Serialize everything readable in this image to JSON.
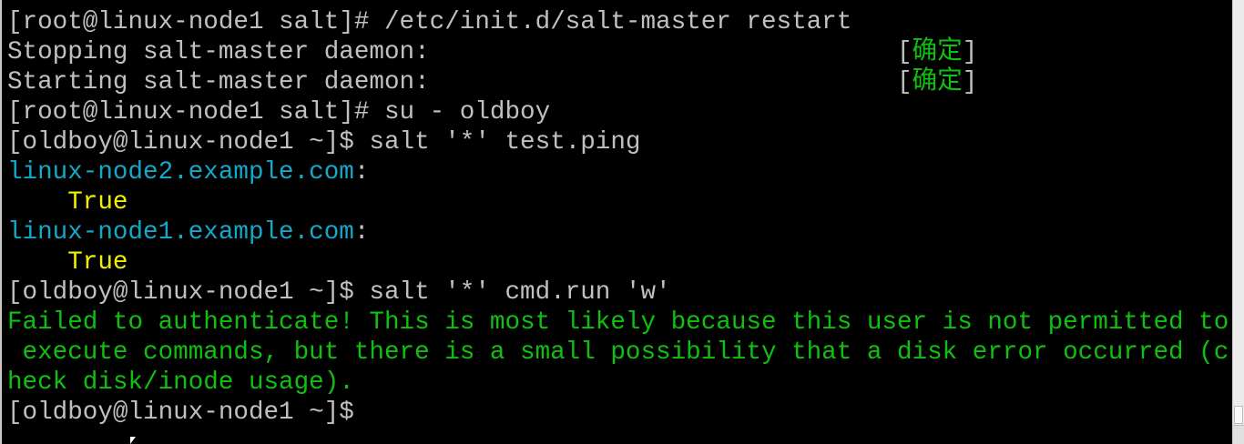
{
  "colors": {
    "default": "#c0c0c0",
    "cyan": "#14a8c8",
    "yellow": "#f0f000",
    "green": "#10c010"
  },
  "lines": [
    [
      {
        "t": "[root@linux-node1 salt]# /etc/init.d/salt-master restart",
        "c": "default"
      }
    ],
    [
      {
        "t": "Stopping salt-master daemon:                               ",
        "c": "default"
      },
      {
        "t": "[",
        "c": "default"
      },
      {
        "t": "确定",
        "c": "green"
      },
      {
        "t": "]",
        "c": "default"
      }
    ],
    [
      {
        "t": "Starting salt-master daemon:                               ",
        "c": "default"
      },
      {
        "t": "[",
        "c": "default"
      },
      {
        "t": "确定",
        "c": "green"
      },
      {
        "t": "]",
        "c": "default"
      }
    ],
    [
      {
        "t": "[root@linux-node1 salt]# su - oldboy",
        "c": "default"
      }
    ],
    [
      {
        "t": "[oldboy@linux-node1 ~]$ salt '*' test.ping",
        "c": "default"
      }
    ],
    [
      {
        "t": "linux-node2.example.com",
        "c": "cyan"
      },
      {
        "t": ":",
        "c": "default"
      }
    ],
    [
      {
        "t": "    True",
        "c": "yellow"
      }
    ],
    [
      {
        "t": "linux-node1.example.com",
        "c": "cyan"
      },
      {
        "t": ":",
        "c": "default"
      }
    ],
    [
      {
        "t": "    True",
        "c": "yellow"
      }
    ],
    [
      {
        "t": "[oldboy@linux-node1 ~]$ salt '*' cmd.run 'w'",
        "c": "default"
      }
    ],
    [
      {
        "t": "Failed to authenticate! This is most likely because this user is not permitted to",
        "c": "green"
      }
    ],
    [
      {
        "t": " execute commands, but there is a small possibility that a disk error occurred (c",
        "c": "green"
      }
    ],
    [
      {
        "t": "heck disk/inode usage).",
        "c": "green"
      }
    ],
    [
      {
        "t": "[oldboy@linux-node1 ~]$",
        "c": "default"
      }
    ]
  ]
}
